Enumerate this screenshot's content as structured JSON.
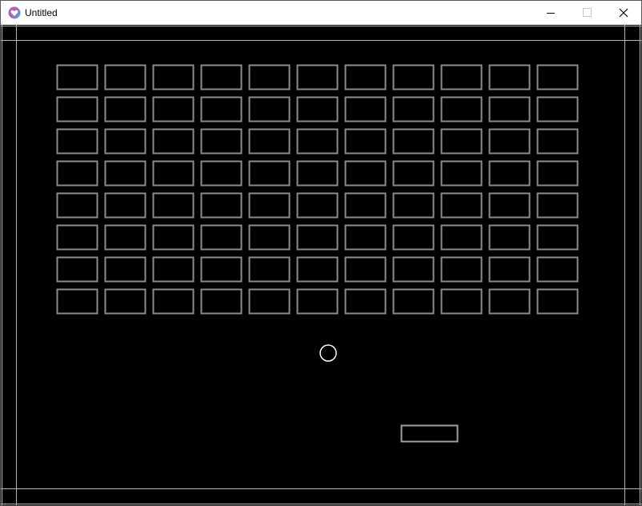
{
  "window": {
    "title": "Untitled",
    "controls": {
      "minimize": "minimize-icon",
      "maximize": "maximize-icon",
      "close": "close-icon"
    }
  },
  "game": {
    "background": "#000000",
    "brick_color": "#8c8c8c",
    "wall_color": "#b4b4b4",
    "ball_color": "#ffffff",
    "paddle_color": "#a0a0a0",
    "brick_grid": {
      "rows": 8,
      "columns": 11,
      "intact": 88
    },
    "ball": "circle",
    "paddle": "rectangle"
  }
}
